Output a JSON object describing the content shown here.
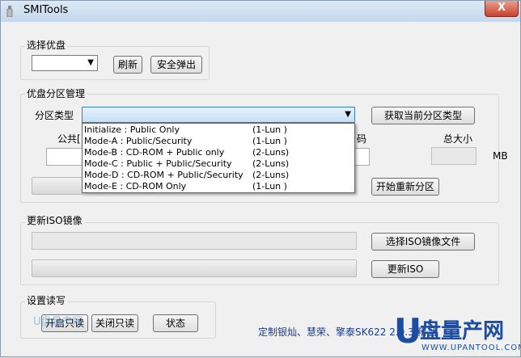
{
  "window": {
    "title": "SMITools",
    "close_symbol": "X"
  },
  "select_disk": {
    "label": "选择优盘",
    "combo_value": "",
    "refresh_button": "刷新",
    "eject_button": "安全弹出"
  },
  "partition_mgmt": {
    "label": "优盘分区管理",
    "type_label": "分区类型",
    "type_value": "",
    "get_type_button": "获取当前分区类型",
    "public_col_label_partial": "公共[",
    "password_col_label_partial": "码",
    "total_size_label": "总大小",
    "mb_unit": "MB",
    "repartition_button": "开始重新分区",
    "dropdown_options": [
      {
        "mode": "Initialize : Public Only",
        "lun": "(1-Lun  )"
      },
      {
        "mode": "Mode-A : Public/Security",
        "lun": "(1-Lun  )"
      },
      {
        "mode": "Mode-B : CD-ROM + Public only",
        "lun": "(2-Luns)"
      },
      {
        "mode": "Mode-C : Public + Public/Security",
        "lun": "(2-Luns)"
      },
      {
        "mode": "Mode-D : CD-ROM + Public/Security",
        "lun": "(2-Luns)"
      },
      {
        "mode": "Mode-E : CD-ROM Only",
        "lun": "(1-Lun  )"
      }
    ]
  },
  "iso_update": {
    "label": "更新ISO镜像",
    "select_iso_button": "选择ISO镜像文件",
    "update_iso_button": "更新ISO"
  },
  "read_write": {
    "label": "设置读写",
    "enable_readonly_button": "开启只读",
    "disable_readonly_button": "关闭只读",
    "status_button": "状态"
  },
  "footer": {
    "text": "定制银灿、慧荣、擎泰SK622  2.0.3         精品"
  },
  "watermark": {
    "left_text": "U盘量产网",
    "logo_letter": "U",
    "logo_text": "盘量产网",
    "logo_url": "WWW.UPANTOOL.COM"
  }
}
